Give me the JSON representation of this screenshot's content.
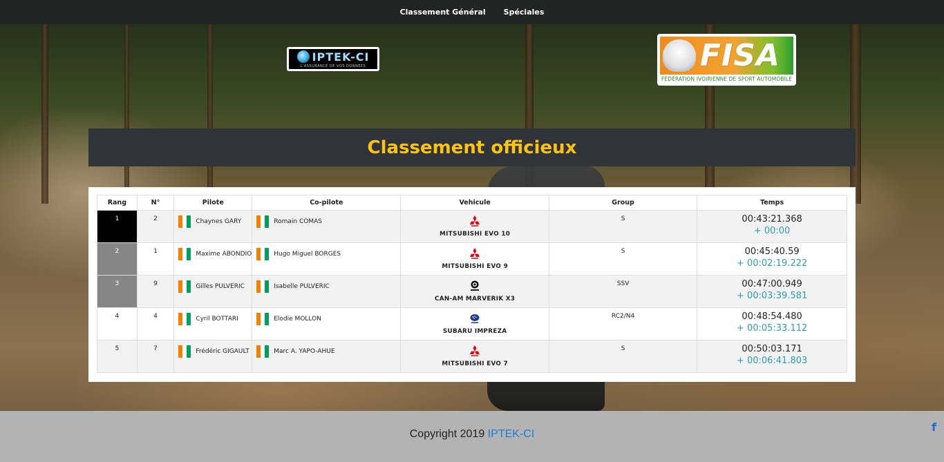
{
  "nav": {
    "items": [
      {
        "label": "Classement Général"
      },
      {
        "label": "Spéciales"
      }
    ]
  },
  "logos": {
    "iptek": {
      "name": "IPTEK-CI",
      "tagline": "L'ASSURANCE DE VOS DONNEES"
    },
    "fisa": {
      "name": "FISA",
      "subtitle": "FÉDÉRATION IVOIRIENNE DE SPORT AUTOMOBILE"
    }
  },
  "page_title": "Classement officieux",
  "table": {
    "headers": {
      "rank": "Rang",
      "num": "N°",
      "pilot": "Pilote",
      "copilot": "Co-pilote",
      "vehicle": "Vehicule",
      "group": "Group",
      "time": "Temps"
    },
    "rows": [
      {
        "rank": "1",
        "num": "2",
        "pilot": "Chaynes GARY",
        "copilot": "Romain COMAS",
        "vehicle": "MITSUBISHI EVO 10",
        "brand_icon": "mitsubishi-logo-icon",
        "group": "S",
        "time": "00:43:21.368",
        "gap": "+ 00:00"
      },
      {
        "rank": "2",
        "num": "1",
        "pilot": "Maxime ABONDIO",
        "copilot": "Hugo Miguel BORGES",
        "vehicle": "MITSUBISHI EVO 9",
        "brand_icon": "mitsubishi-logo-icon",
        "group": "S",
        "time": "00:45:40.59",
        "gap": "+ 00:02:19.222"
      },
      {
        "rank": "3",
        "num": "9",
        "pilot": "Gilles PULVERIC",
        "copilot": "Isabelle PULVERIC",
        "vehicle": "CAN-AM MARVERIK X3",
        "brand_icon": "can-am-logo-icon",
        "group": "SSV",
        "time": "00:47:00.949",
        "gap": "+ 00:03:39.581"
      },
      {
        "rank": "4",
        "num": "4",
        "pilot": "Cyril BOTTARI",
        "copilot": "Elodie MOLLON",
        "vehicle": "SUBARU IMPREZA",
        "brand_icon": "subaru-logo-icon",
        "group": "RC2/N4",
        "time": "00:48:54.480",
        "gap": "+ 00:05:33.112"
      },
      {
        "rank": "5",
        "num": "7",
        "pilot": "Frédéric GIGAULT",
        "copilot": "Marc A. YAPO-AHUE",
        "vehicle": "MITSUBISHI EVO 7",
        "brand_icon": "mitsubishi-logo-icon",
        "group": "S",
        "time": "00:50:03.171",
        "gap": "+ 00:06:41.803"
      }
    ]
  },
  "footer": {
    "copyright": "Copyright 2019",
    "brand": "IPTEK-CI",
    "social_icon": "facebook-icon",
    "social_glyph": "f"
  },
  "colors": {
    "accent": "#fcc40f",
    "link": "#1a7fd6",
    "gap": "#2a9fb0",
    "ci_orange": "#f77f00",
    "ci_green": "#009e60"
  }
}
